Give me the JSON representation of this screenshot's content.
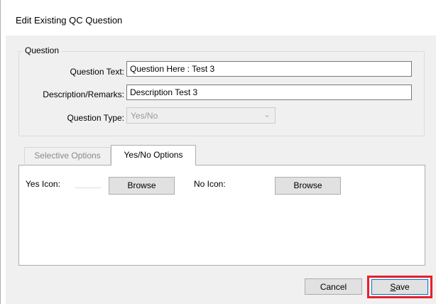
{
  "window": {
    "title": "Edit Existing QC Question"
  },
  "question_group": {
    "legend": "Question",
    "question_text_label": "Question Text:",
    "question_text_value": "Question Here : Test 3",
    "description_label": "Description/Remarks:",
    "description_value": "Description Test 3",
    "question_type_label": "Question Type:",
    "question_type_value": "Yes/No"
  },
  "tabs": [
    {
      "label": "Selective Options",
      "selected": false
    },
    {
      "label": "Yes/No Options",
      "selected": true
    }
  ],
  "yes_no_panel": {
    "yes_icon_label": "Yes Icon:",
    "no_icon_label": "No Icon:",
    "browse_label": "Browse"
  },
  "footer": {
    "cancel_label": "Cancel",
    "save_mnemonic": "S",
    "save_rest": "ave"
  },
  "colors": {
    "client_background": "#f0f0f0",
    "highlight": "#e8202a",
    "focus_border": "#0078d7",
    "disabled_text": "#9a9a9a"
  },
  "icons": {
    "dropdown": "chevron-down-icon"
  }
}
